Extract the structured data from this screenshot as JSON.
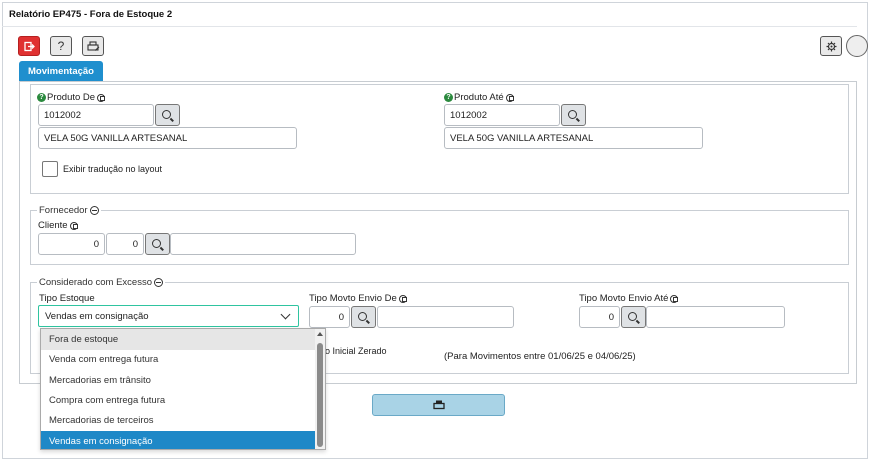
{
  "window": {
    "title": "Relatório EP475 - Fora de Estoque 2"
  },
  "toolbar": {
    "exit_icon": "exit-icon",
    "help_label": "?",
    "print_icon": "print-icon",
    "settings_icon": "gear-icon"
  },
  "tabs": [
    {
      "label": "Movimentação",
      "active": true
    }
  ],
  "produto": {
    "de_label": "Produto De",
    "de_code": "1012002",
    "de_desc": "VELA 50G VANILLA ARTESANAL",
    "ate_label": "Produto Até",
    "ate_code": "1012002",
    "ate_desc": "VELA 50G VANILLA ARTESANAL",
    "traducao_label": "Exibir tradução no layout",
    "traducao_checked": false
  },
  "fornecedor": {
    "legend": "Fornecedor",
    "cliente_label": "Cliente",
    "cliente_code1": "0",
    "cliente_code2": "0",
    "cliente_name": ""
  },
  "excesso": {
    "legend": "Considerado com Excesso",
    "tipo_estoque_label": "Tipo Estoque",
    "tipo_estoque_value": "Vendas em consignação",
    "tipo_movto_de_label": "Tipo Movto Envio De",
    "tipo_movto_de_value": "0",
    "tipo_movto_ate_label": "Tipo Movto Envio Até",
    "tipo_movto_ate_value": "0",
    "saldo_partial_label": "o Inicial Zerado",
    "periodo_text": "(Para Movimentos entre 01/06/25 e 04/06/25)"
  },
  "dropdown": {
    "options": [
      "Fora de estoque",
      "Venda com entrega futura",
      "Mercadorias em trânsito",
      "Compra com entrega futura",
      "Mercadorias de terceiros",
      "Vendas em consignação"
    ],
    "hovered_index": 0,
    "selected_index": 5
  },
  "footer": {
    "print_icon": "print-icon"
  },
  "colors": {
    "accent": "#1f8fce",
    "exit_red": "#e03131",
    "focus_border": "#2fc4a0",
    "selected_option": "#1e88c7",
    "print_button": "#a9d3e6"
  }
}
